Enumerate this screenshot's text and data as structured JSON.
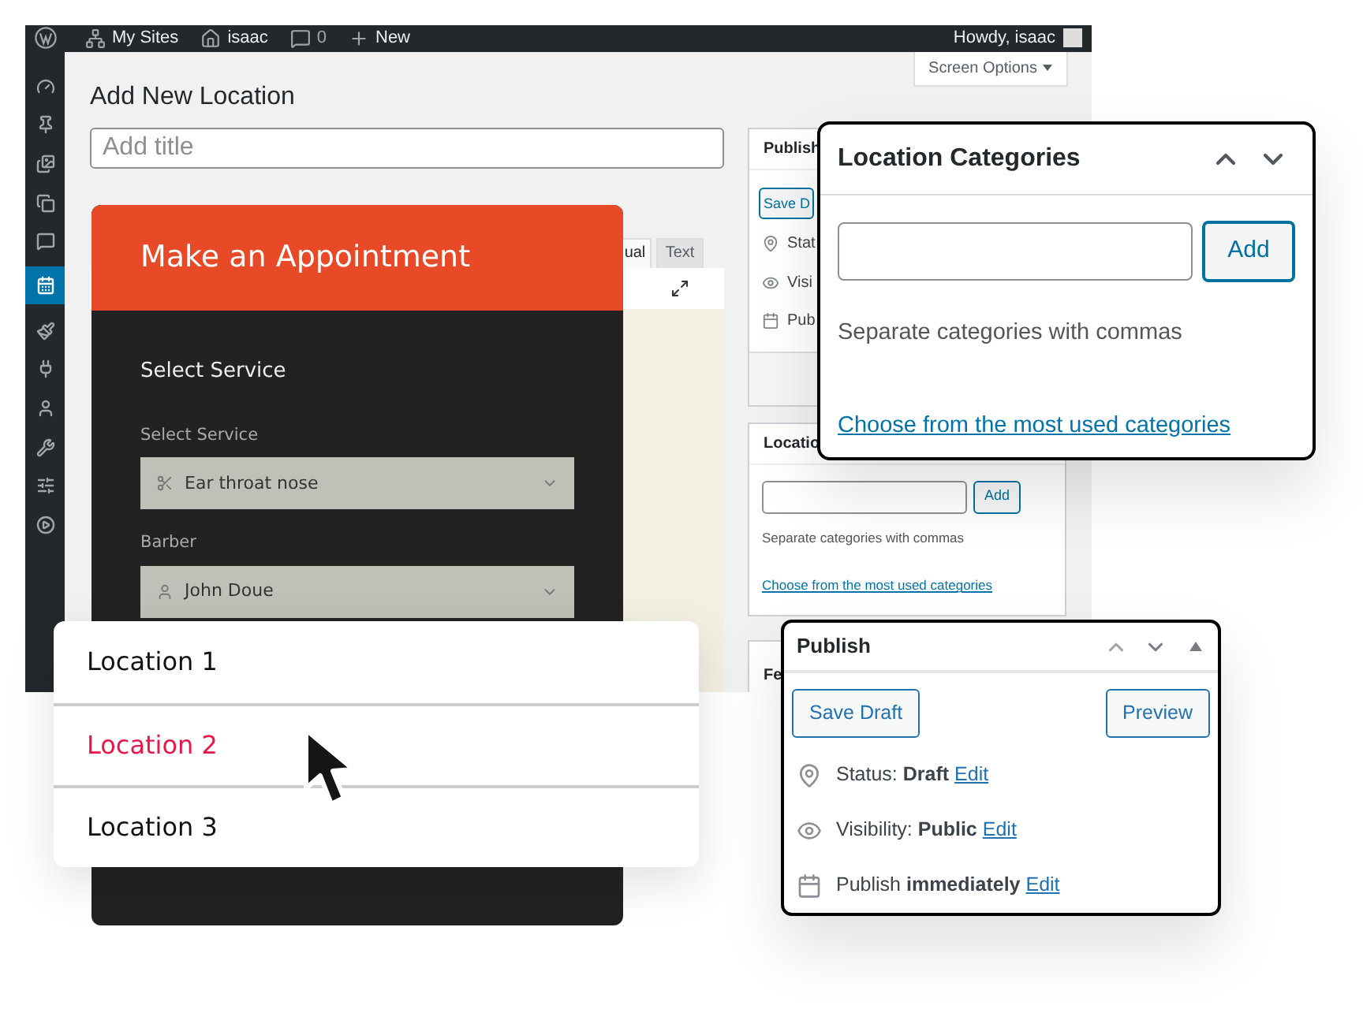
{
  "admin_bar": {
    "items": [
      {
        "label": "My Sites"
      },
      {
        "label": "isaac"
      },
      {
        "label": "0"
      },
      {
        "label": "New"
      }
    ],
    "greeting": "Howdy, isaac"
  },
  "sidebar": {
    "items": [
      {
        "selected": false
      },
      {
        "selected": false
      },
      {
        "selected": false
      },
      {
        "selected": false
      },
      {
        "selected": false
      },
      {
        "selected": true
      },
      {
        "selected": false
      },
      {
        "selected": false
      },
      {
        "selected": false
      },
      {
        "selected": false
      },
      {
        "selected": false
      },
      {
        "selected": false
      }
    ]
  },
  "screen_options": "Screen Options",
  "page_title": "Add New Location",
  "title_field": {
    "placeholder": "Add title"
  },
  "editor_tabs": [
    {
      "label": "ual",
      "selected": true
    },
    {
      "label": "Text",
      "selected": false
    }
  ],
  "publish_box": {
    "title": "Publish",
    "save_button": "Save D",
    "rows": [
      "Stat",
      "Visi",
      "Pub"
    ]
  },
  "categories_box": {
    "title": "Locatio",
    "add_button": "Add",
    "hint": "Separate categories with commas",
    "link": "Choose from the most used categories"
  },
  "featured_box": {
    "title": "Fe"
  },
  "appointment": {
    "title": "Make an Appointment",
    "section": "Select Service",
    "fields": [
      {
        "label": "Select Service",
        "value": "Ear throat nose"
      },
      {
        "label": "Barber",
        "value": "John Doue"
      }
    ]
  },
  "location_menu": {
    "options": [
      {
        "label": "Location 1",
        "selected": false
      },
      {
        "label": "Location 2",
        "selected": true
      },
      {
        "label": "Location 3",
        "selected": false
      }
    ]
  },
  "categories_popup": {
    "title": "Location Categories",
    "add_button": "Add",
    "hint": "Separate categories with commas",
    "link": "Choose from the most used categories"
  },
  "publish_popup": {
    "title": "Publish",
    "save_button": "Save Draft",
    "preview_button": "Preview",
    "rows": [
      {
        "text": "Status: **Draft**",
        "link": "Edit"
      },
      {
        "text": "Visibility: **Public**",
        "link": "Edit"
      },
      {
        "text": "Publish **immediately**",
        "link": "Edit"
      }
    ]
  }
}
